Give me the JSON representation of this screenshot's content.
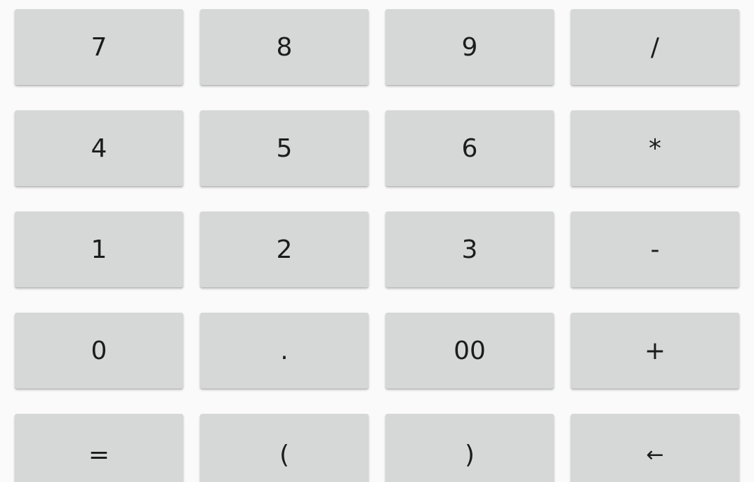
{
  "keypad": {
    "rows": [
      [
        {
          "label": "7"
        },
        {
          "label": "8"
        },
        {
          "label": "9"
        },
        {
          "label": "/"
        }
      ],
      [
        {
          "label": "4"
        },
        {
          "label": "5"
        },
        {
          "label": "6"
        },
        {
          "label": "*"
        }
      ],
      [
        {
          "label": "1"
        },
        {
          "label": "2"
        },
        {
          "label": "3"
        },
        {
          "label": "-"
        }
      ],
      [
        {
          "label": "0"
        },
        {
          "label": "."
        },
        {
          "label": "00"
        },
        {
          "label": "+"
        }
      ],
      [
        {
          "label": "="
        },
        {
          "label": "("
        },
        {
          "label": ")"
        },
        {
          "label": "←"
        }
      ]
    ]
  },
  "colors": {
    "background": "#fafafa",
    "key_background": "#d6d7d7",
    "key_text": "#1c1c1c"
  }
}
